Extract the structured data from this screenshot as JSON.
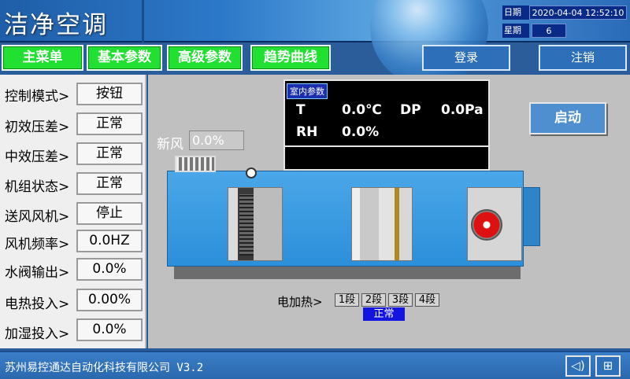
{
  "header": {
    "title": "洁净空调",
    "date_label": "日期",
    "date_value": "2020-04-04 12:52:10",
    "weekday_label": "星期",
    "weekday_value": "6"
  },
  "nav": {
    "main_menu": "主菜单",
    "basic_params": "基本参数",
    "advanced_params": "高级参数",
    "trend_curve": "趋势曲线",
    "login": "登录",
    "logout": "注销"
  },
  "params": [
    {
      "label": "控制模式>",
      "value": "按钮"
    },
    {
      "label": "初效压差>",
      "value": "正常"
    },
    {
      "label": "中效压差>",
      "value": "正常"
    },
    {
      "label": "机组状态>",
      "value": "正常"
    },
    {
      "label": "送风风机>",
      "value": "停止"
    },
    {
      "label": "风机频率>",
      "value": "0.0HZ"
    },
    {
      "label": "水阀输出>",
      "value": "0.0%"
    },
    {
      "label": "电热投入>",
      "value": "0.00%"
    },
    {
      "label": "加湿投入>",
      "value": "0.0%"
    }
  ],
  "indoor": {
    "title": "室内参数",
    "t_label": "T",
    "t_value": "0.0℃",
    "dp_label": "DP",
    "dp_value": "0.0Pa",
    "rh_label": "RH",
    "rh_value": "0.0%"
  },
  "start_button": "启动",
  "fresh_air": {
    "label": "新风",
    "value": "0.0%"
  },
  "electric_heat": {
    "label": "电加热>",
    "segments": [
      "1段",
      "2段",
      "3段",
      "4段"
    ],
    "status": "正常"
  },
  "footer": {
    "company": "苏州易控通达自动化科技有限公司 V3.2",
    "sound_icon": "speaker-icon",
    "network_icon": "network-icon"
  },
  "colors": {
    "nav_green": "#22e032",
    "header_blue": "#2c78c8",
    "status_blue": "#1414e0"
  }
}
